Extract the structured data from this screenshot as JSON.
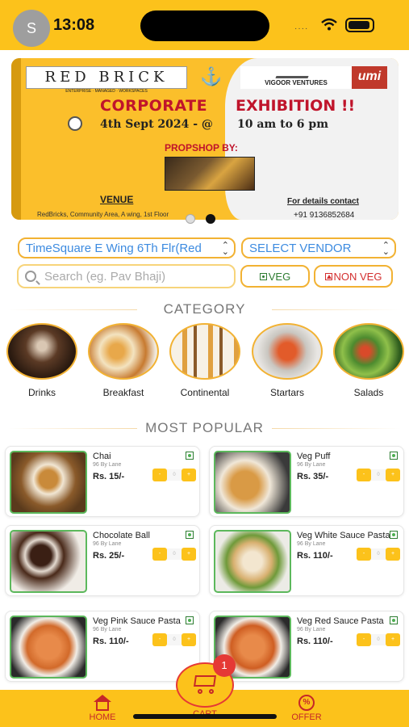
{
  "status_bar": {
    "avatar_initial": "S",
    "time": "13:08",
    "signal": "····"
  },
  "banner": {
    "brand_left": "RED BRICK",
    "brand_left_sub": "ENTERPRISE · MANAGED · WORKSPACES",
    "brand_right": "VIGOOR VENTURES",
    "brand_right2": "umi",
    "title_part1": "CORPORATE",
    "title_part2": "EXHIBITION !!",
    "date_part1": "4th Sept 2024 - @",
    "date_part2": "10 am to 6 pm",
    "propshop_label": "PROPSHOP BY:",
    "venue_label": "VENUE",
    "venue_address": "RedBricks, Community Area, A wing, 1st Floor",
    "contact_label": "For details contact",
    "contact_phone": "+91 9136852684",
    "page_dots": 2,
    "active_dot": 2
  },
  "filters": {
    "location": "TimeSquare E Wing 6Th Flr(Red",
    "vendor": "SELECT VENDOR",
    "search_placeholder": "Search (eg. Pav Bhaji)",
    "veg_label": "VEG",
    "nonveg_label": "NON VEG"
  },
  "categories": {
    "heading": "CATEGORY",
    "items": [
      {
        "label": "Drinks"
      },
      {
        "label": "Breakfast"
      },
      {
        "label": "Continental"
      },
      {
        "label": "Startars"
      },
      {
        "label": "Salads"
      }
    ]
  },
  "popular": {
    "heading": "MOST POPULAR",
    "items": [
      {
        "name": "Chai",
        "vendor": "96 By Lane",
        "price": "Rs. 15/-"
      },
      {
        "name": "Veg Puff",
        "vendor": "96 By Lane",
        "price": "Rs. 35/-"
      },
      {
        "name": "Chocolate Ball",
        "vendor": "96 By Lane",
        "price": "Rs. 25/-"
      },
      {
        "name": "Veg White Sauce Pasta",
        "vendor": "96 By Lane",
        "price": "Rs. 110/-"
      },
      {
        "name": "Veg Pink Sauce Pasta",
        "vendor": "96 By Lane",
        "price": "Rs. 110/-"
      },
      {
        "name": "Veg Red Sauce Pasta",
        "vendor": "96 By Lane",
        "price": "Rs. 110/-"
      }
    ],
    "stepper_minus": "-",
    "stepper_qty": "0",
    "stepper_plus": "+"
  },
  "bottom_nav": {
    "home": "HOME",
    "cart": "CART",
    "offer": "OFFER",
    "cart_count": "1"
  },
  "colors": {
    "accent": "#fcc21b",
    "brand_red": "#c62828",
    "veg_green": "#4caf50",
    "link_blue": "#3d8be0"
  }
}
